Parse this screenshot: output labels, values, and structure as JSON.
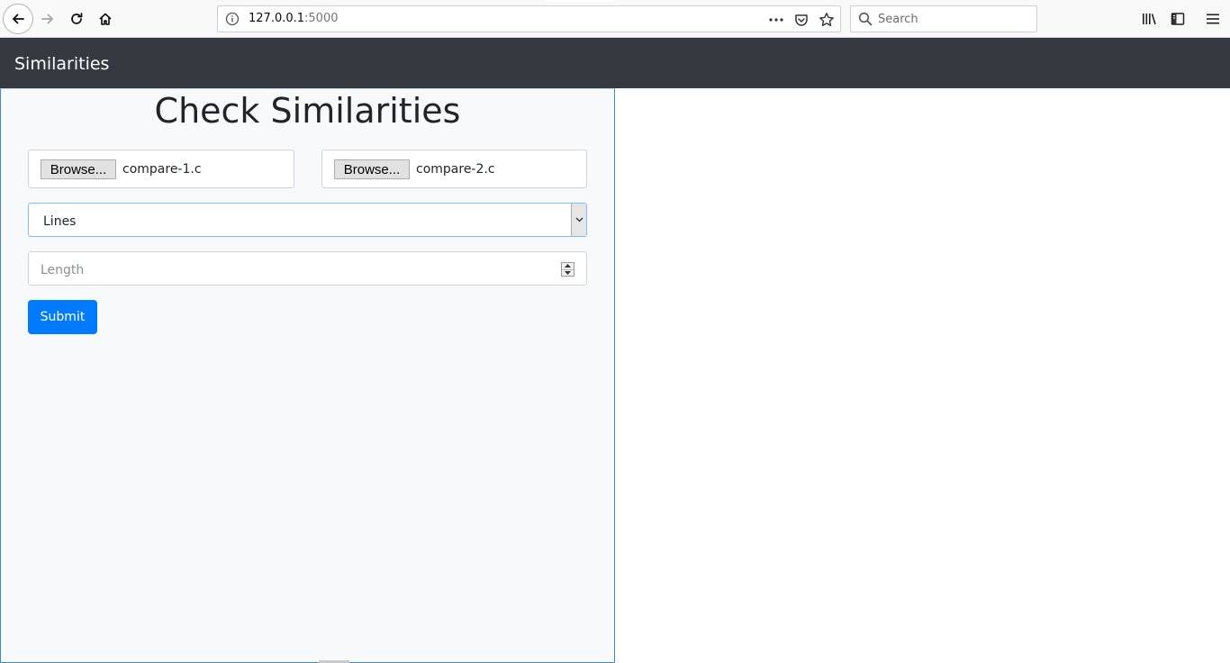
{
  "browser": {
    "url_host": "127.0.0.1",
    "url_port": ":5000",
    "search_placeholder": "Search"
  },
  "navbar": {
    "brand": "Similarities"
  },
  "form": {
    "title": "Check Similarities",
    "file1": {
      "button_label": "Browse...",
      "file_name": "compare-1.c"
    },
    "file2": {
      "button_label": "Browse...",
      "file_name": "compare-2.c"
    },
    "mode_select": {
      "selected": "Lines"
    },
    "length_field": {
      "placeholder": "Length"
    },
    "submit_label": "Submit"
  },
  "colors": {
    "navbar_bg": "#343a40",
    "panel_bg": "#f8f9fa",
    "primary": "#007bff"
  }
}
